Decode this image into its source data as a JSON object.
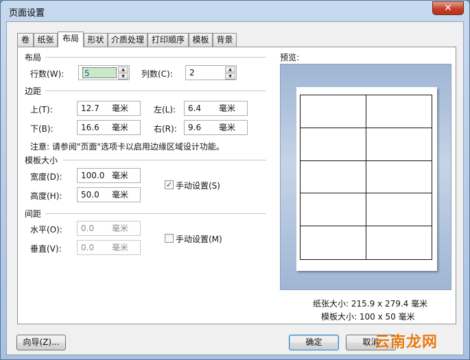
{
  "window": {
    "title": "页面设置",
    "close_label": "✕"
  },
  "tabs": [
    {
      "label": "卷"
    },
    {
      "label": "纸张"
    },
    {
      "label": "布局"
    },
    {
      "label": "形状"
    },
    {
      "label": "介质处理"
    },
    {
      "label": "打印顺序"
    },
    {
      "label": "模板"
    },
    {
      "label": "背景"
    }
  ],
  "active_tab": "布局",
  "layout": {
    "label": "布局",
    "rows_label": "行数(W):",
    "rows_value": "5",
    "cols_label": "列数(C):",
    "cols_value": "2"
  },
  "margins": {
    "label": "边距",
    "top_label": "上(T):",
    "top_value": "12.7",
    "top_unit": "毫米",
    "left_label": "左(L):",
    "left_value": "6.4",
    "left_unit": "毫米",
    "bottom_label": "下(B):",
    "bottom_value": "16.6",
    "bottom_unit": "毫米",
    "right_label": "右(R):",
    "right_value": "9.6",
    "right_unit": "毫米",
    "note": "注意: 请参阅\"页面\"选项卡以启用边缘区域设计功能。"
  },
  "template_size": {
    "label": "模板大小",
    "width_label": "宽度(D):",
    "width_value": "100.0",
    "width_unit": "毫米",
    "height_label": "高度(H):",
    "height_value": "50.0",
    "height_unit": "毫米",
    "manual_label": "手动设置(S)",
    "manual_checked": true
  },
  "spacing": {
    "label": "间距",
    "horizontal_label": "水平(O):",
    "horizontal_value": "0.0",
    "horizontal_unit": "毫米",
    "vertical_label": "垂直(V):",
    "vertical_value": "0.0",
    "vertical_unit": "毫米",
    "manual_label": "手动设置(M)",
    "manual_checked": false
  },
  "preview": {
    "label": "预览:",
    "paper_size": "纸张大小: 215.9 x 279.4 毫米",
    "template_size": "模板大小: 100 x 50 毫米",
    "rows": 5,
    "cols": 2
  },
  "buttons": {
    "wizard": "向导(Z)...",
    "ok": "确定",
    "cancel": "取消"
  },
  "watermark": "云南龙网",
  "colors": {
    "title_bar": "#c7d9ee",
    "selection": "#cbe8cb",
    "close": "#c4402a",
    "watermark": "#e67a14"
  }
}
